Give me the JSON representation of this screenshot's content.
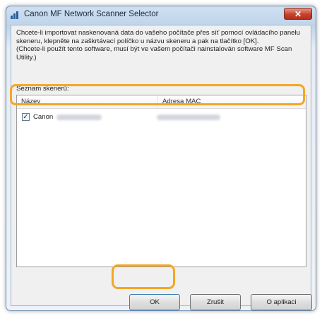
{
  "window": {
    "title": "Canon MF Network Scanner Selector",
    "close_glyph": "✕"
  },
  "instructions": {
    "paragraph1": "Chcete-li importovat naskenovaná data do vašeho počítače přes síť pomocí ovládacího panelu skeneru, klepněte na zaškrtávací políčko u názvu skeneru a pak na tlačítko [OK].",
    "paragraph2": "(Chcete-li použít tento software, musí být ve vašem počítači nainstalován software MF Scan Utility.)"
  },
  "scanner_list": {
    "caption": "Seznam skenerů:",
    "columns": [
      "Název",
      "Adresa MAC"
    ],
    "rows": [
      {
        "checked": true,
        "check_glyph": "✓",
        "name": "Canon"
      }
    ]
  },
  "buttons": {
    "ok": "OK",
    "close": "Zrušit",
    "about": "O aplikaci"
  },
  "colors": {
    "highlight": "#f5a623",
    "close_button": "#c8412c"
  }
}
